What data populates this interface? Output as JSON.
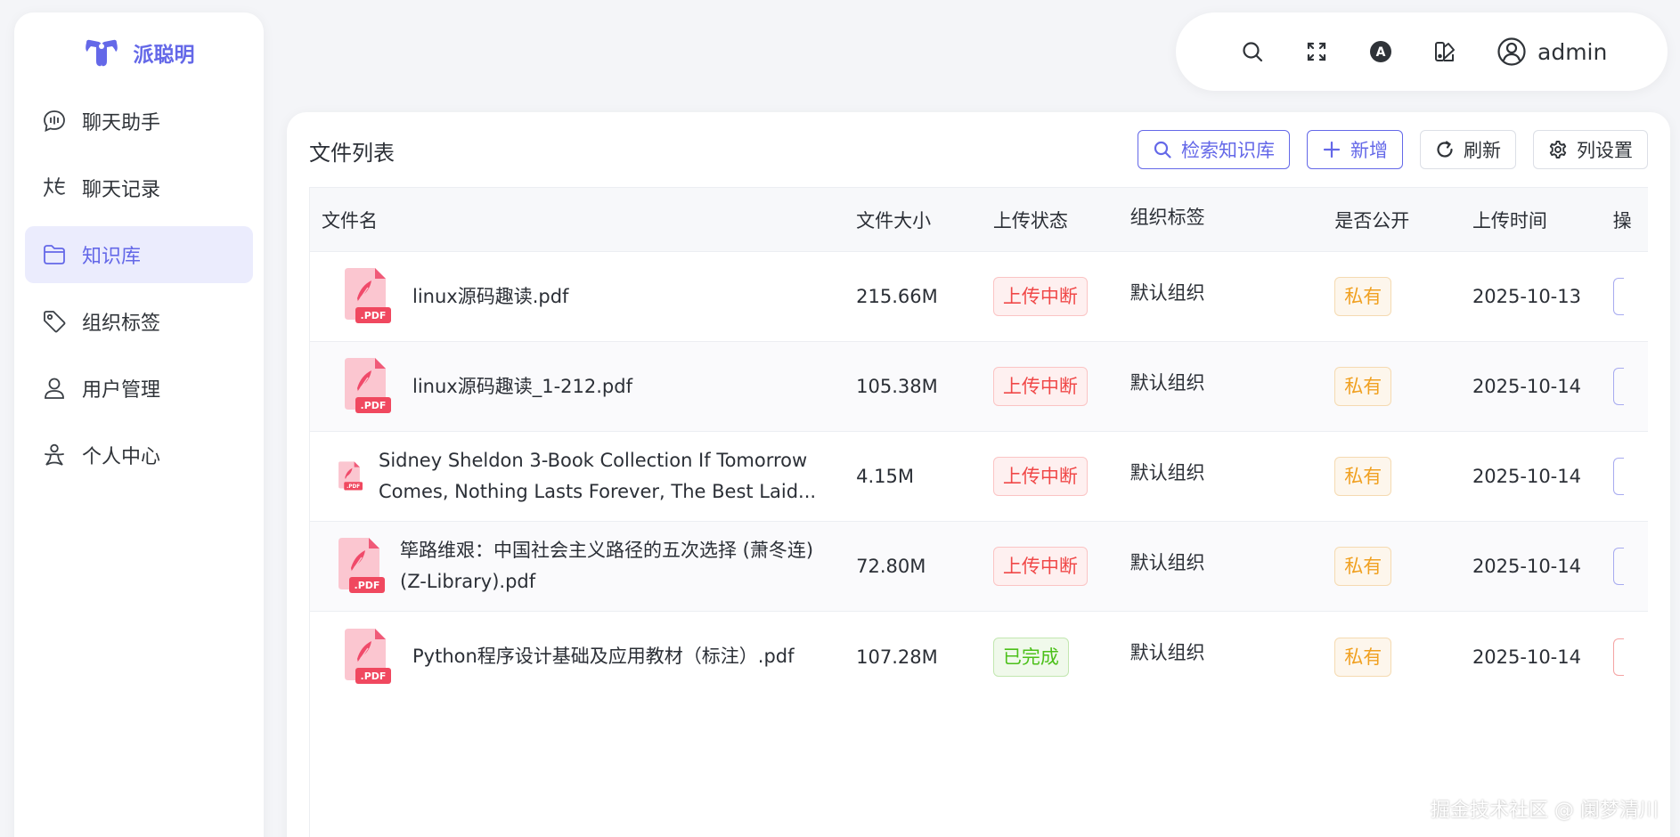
{
  "app": {
    "brand": "派聪明"
  },
  "sidebar": {
    "items": [
      {
        "label": "聊天助手",
        "icon": "chat-bubble-icon"
      },
      {
        "label": "聊天记录",
        "icon": "chat-history-icon"
      },
      {
        "label": "知识库",
        "icon": "folder-icon",
        "active": true
      },
      {
        "label": "组织标签",
        "icon": "tag-icon"
      },
      {
        "label": "用户管理",
        "icon": "user-icon"
      },
      {
        "label": "个人中心",
        "icon": "personal-center-icon"
      }
    ]
  },
  "header": {
    "username": "admin"
  },
  "main": {
    "title": "文件列表",
    "toolbar": {
      "search_kb": "检索知识库",
      "add": "新增",
      "refresh": "刷新",
      "column_settings": "列设置"
    },
    "columns": [
      "文件名",
      "文件大小",
      "上传状态",
      "组织标签",
      "是否公开",
      "上传时间",
      "操"
    ],
    "rows": [
      {
        "name": "linux源码趣读.pdf",
        "size": "215.66M",
        "status": "上传中断",
        "org": "默认组织",
        "public": "私有",
        "time": "2025-10-13"
      },
      {
        "name": "linux源码趣读_1-212.pdf",
        "size": "105.38M",
        "status": "上传中断",
        "org": "默认组织",
        "public": "私有",
        "time": "2025-10-14"
      },
      {
        "name": "Sidney Sheldon 3-Book Collection If Tomorrow Comes, Nothing Lasts Forever, The Best Laid...",
        "size": "4.15M",
        "status": "上传中断",
        "org": "默认组织",
        "public": "私有",
        "time": "2025-10-14"
      },
      {
        "name": "筚路维艰：中国社会主义路径的五次选择 (萧冬连) (Z-Library).pdf",
        "size": "72.80M",
        "status": "上传中断",
        "org": "默认组织",
        "public": "私有",
        "time": "2025-10-14"
      },
      {
        "name": "Python程序设计基础及应用教材（标注）.pdf",
        "size": "107.28M",
        "status": "已完成",
        "org": "默认组织",
        "public": "私有",
        "time": "2025-10-14"
      }
    ]
  },
  "pdf_badge": ".PDF",
  "watermark": "掘金技术社区 @ 阑梦清川",
  "colors": {
    "accent": "#6468e8",
    "danger": "#f04848",
    "success": "#4cc01a",
    "warning": "#f0a020"
  }
}
